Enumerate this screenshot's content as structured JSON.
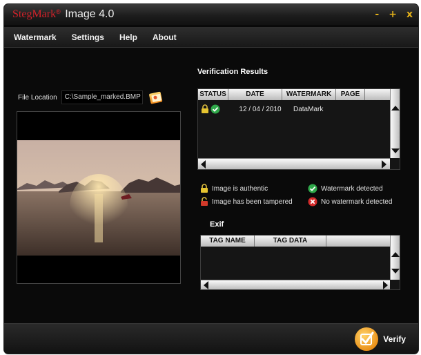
{
  "window": {
    "brand": "StegMark",
    "brand_mark": "®",
    "product": "Image 4.0",
    "controls": [
      "-",
      "+",
      "x"
    ]
  },
  "menu": [
    "Watermark",
    "Settings",
    "Help",
    "About"
  ],
  "file": {
    "label": "File Location",
    "value": "C:\\Sample_marked.BMP",
    "browse_icon": "folder-image-icon"
  },
  "verification": {
    "title": "Verification Results",
    "columns": [
      "STATUS",
      "DATE",
      "WATERMARK",
      "PAGE"
    ],
    "rows": [
      {
        "status_icons": [
          "lock-icon",
          "check-icon"
        ],
        "date": "12 / 04 / 2010",
        "watermark": "DataMark",
        "page": ""
      }
    ]
  },
  "legend": [
    {
      "icon": "lock-closed-icon",
      "label": "Image is authentic"
    },
    {
      "icon": "green-check-icon",
      "label": "Watermark detected"
    },
    {
      "icon": "lock-open-icon",
      "label": "Image has been tampered"
    },
    {
      "icon": "red-x-icon",
      "label": "No watermark detected"
    }
  ],
  "exif": {
    "title": "Exif",
    "columns": [
      "TAG NAME",
      "TAG DATA"
    ]
  },
  "verify": {
    "label": "Verify",
    "icon": "checkbox-check-icon"
  },
  "colors": {
    "brand": "#d3222a",
    "accent": "#e2b01a",
    "background": "#0a0a0a"
  }
}
